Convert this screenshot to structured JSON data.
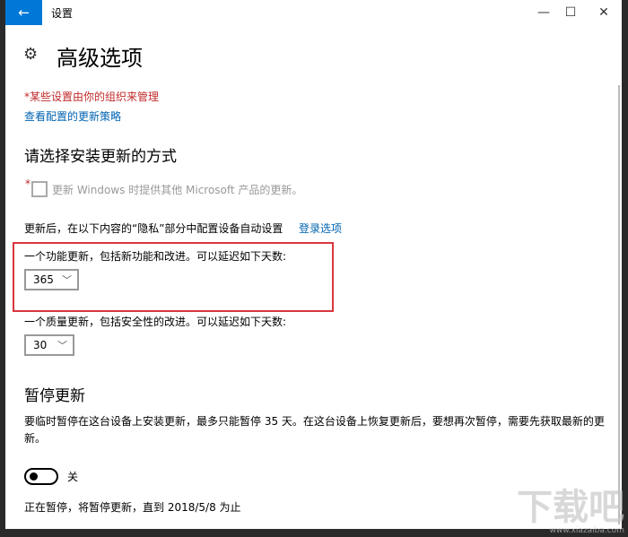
{
  "window": {
    "title": "设置",
    "back_icon": "arrow-left",
    "minimize": "—",
    "maximize": "☐",
    "close": "✕"
  },
  "header": {
    "title": "高级选项"
  },
  "notice": {
    "managed": "*某些设置由你的组织来管理",
    "policy_link": "查看配置的更新策略"
  },
  "install": {
    "heading": "请选择安装更新的方式",
    "checkbox_label": "更新 Windows 时提供其他 Microsoft 产品的更新。",
    "checkbox_checked": false,
    "asterisk": "*"
  },
  "privacy": {
    "text": "更新后，在以下内容的“隐私”部分中配置设备自动设置",
    "link": "登录选项"
  },
  "feature": {
    "label": "一个功能更新，包括新功能和改进。可以延迟如下天数:",
    "value": "365"
  },
  "quality": {
    "label": "一个质量更新，包括安全性的改进。可以延迟如下天数:",
    "value": "30"
  },
  "pause": {
    "heading": "暂停更新",
    "description": "要临时暂停在这台设备上安装更新，最多只能暂停 35 天。在这台设备上恢复更新后，要想再次暂停，需要先获取最新的更新。",
    "toggle_state": "关",
    "status": "正在暂停，将暂停更新，直到 2018/5/8 为止"
  },
  "watermark": {
    "logo": "下载吧",
    "url": "www.xiazaiba.com"
  },
  "colors": {
    "accent": "#0078d7",
    "highlight": "#d9363e"
  }
}
